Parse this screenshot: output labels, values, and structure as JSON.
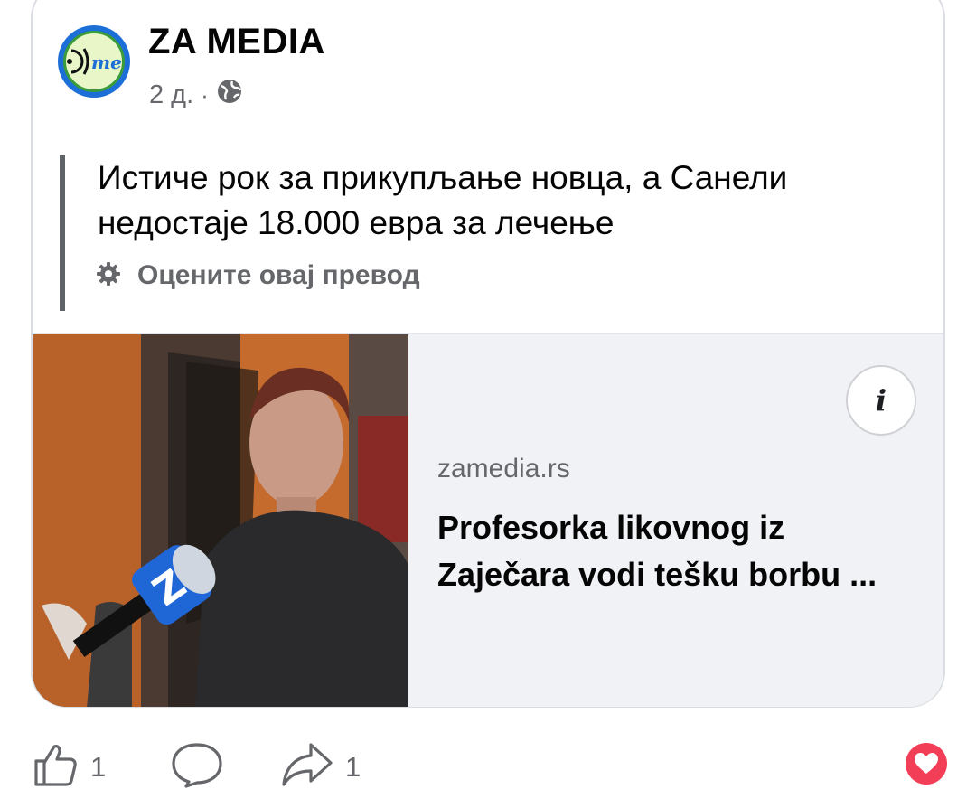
{
  "post": {
    "page_name": "ZA MEDIA",
    "time": "2 д.",
    "separator": "·",
    "audience_icon": "globe-icon",
    "text": "Истиче рок за прикупљање новца, а Санели недостаје 18.000 евра за лечење",
    "translate_label": "Оцените овај превод",
    "translate_icon": "gear-icon"
  },
  "link": {
    "domain": "zamedia.rs",
    "headline": "Profesorka likovnog iz Zaječara vodi tešku borbu ...",
    "info_label": "i"
  },
  "actions": {
    "like_count": "1",
    "share_count": "1",
    "reaction_icon": "love-reaction-icon"
  },
  "colors": {
    "secondary_text": "#65676b",
    "love": "#f33e58",
    "preview_bg": "#f0f2f5"
  }
}
